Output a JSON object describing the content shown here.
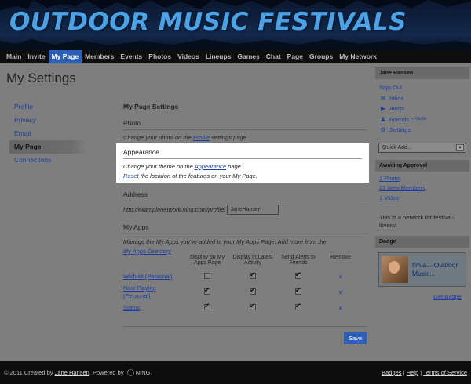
{
  "banner": {
    "title": "OUTDOOR MUSIC FESTIVALS"
  },
  "nav": {
    "tabs": [
      {
        "label": "Main",
        "active": false
      },
      {
        "label": "Invite",
        "active": false
      },
      {
        "label": "My Page",
        "active": true
      },
      {
        "label": "Members",
        "active": false
      },
      {
        "label": "Events",
        "active": false
      },
      {
        "label": "Photos",
        "active": false
      },
      {
        "label": "Videos",
        "active": false
      },
      {
        "label": "Lineups",
        "active": false
      },
      {
        "label": "Games",
        "active": false
      },
      {
        "label": "Chat",
        "active": false
      },
      {
        "label": "Page",
        "active": false
      },
      {
        "label": "Groups",
        "active": false
      },
      {
        "label": "My Network",
        "active": false
      }
    ]
  },
  "page": {
    "title": "My Settings"
  },
  "sidenav": {
    "items": [
      {
        "label": "Profile"
      },
      {
        "label": "Privacy"
      },
      {
        "label": "Email"
      },
      {
        "label": "My Page"
      },
      {
        "label": "Connections"
      }
    ]
  },
  "main": {
    "title": "My Page Settings",
    "photo": {
      "heading": "Photo",
      "text_before": "Change your photo on the ",
      "link": "Profile",
      "text_after": " settings page."
    },
    "appearance": {
      "heading": "Appearance",
      "line1_before": "Change your theme on the ",
      "line1_link": "Appearance",
      "line1_after": " page.",
      "line2_link": "Reset",
      "line2_after": " the location of the features on your My Page."
    },
    "address": {
      "heading": "Address",
      "prefix": "http://examplenetwork.ning.com/profile/",
      "value": "JaneHansen"
    },
    "myapps": {
      "heading": "My Apps",
      "desc": "Manage the My Apps you've added to your My Apps Page. Add more from the",
      "link": "My Apps Directory"
    },
    "apps_table": {
      "headers": [
        "Display on My Apps Page",
        "Display in Latest Activity",
        "Send Alerts to Friends",
        "Remove"
      ],
      "rows": [
        {
          "name": "Wishlist (Personal)",
          "display_page": false,
          "latest_activity": true,
          "alerts": true,
          "remove": "×"
        },
        {
          "name": "Now Playing (Personal)",
          "display_page": true,
          "latest_activity": true,
          "alerts": true,
          "remove": "×"
        },
        {
          "name": "Status",
          "display_page": true,
          "latest_activity": true,
          "alerts": true,
          "remove": "×"
        }
      ]
    },
    "save_label": "Save"
  },
  "sidebar": {
    "user_name": "Jane Hansen",
    "links": [
      {
        "label": "Sign Out",
        "icon": ""
      },
      {
        "label": "Inbox",
        "icon": "inbox-icon"
      },
      {
        "label": "Alerts",
        "icon": "alerts-icon"
      },
      {
        "label": "Friends",
        "icon": "friends-icon",
        "extra": "– Invite"
      },
      {
        "label": "Settings",
        "icon": "settings-icon"
      }
    ],
    "quick_add": "Quick Add...",
    "approval": {
      "heading": "Awaiting Approval",
      "items": [
        "1 Photo",
        "23 New Members",
        "1 Video"
      ]
    },
    "network_text": "This is a network for festival-lovers!",
    "badge": {
      "heading": "Badge",
      "text": "I'm a... Outdoor Music...",
      "get_badge": "Get Badge"
    }
  },
  "footer": {
    "copyright": "© 2011   Created by",
    "creator": "Jane Hansen",
    "powered": ".   Powered by",
    "ning": "NING.",
    "links": [
      "Badges",
      "Help",
      "Terms of Service"
    ]
  }
}
